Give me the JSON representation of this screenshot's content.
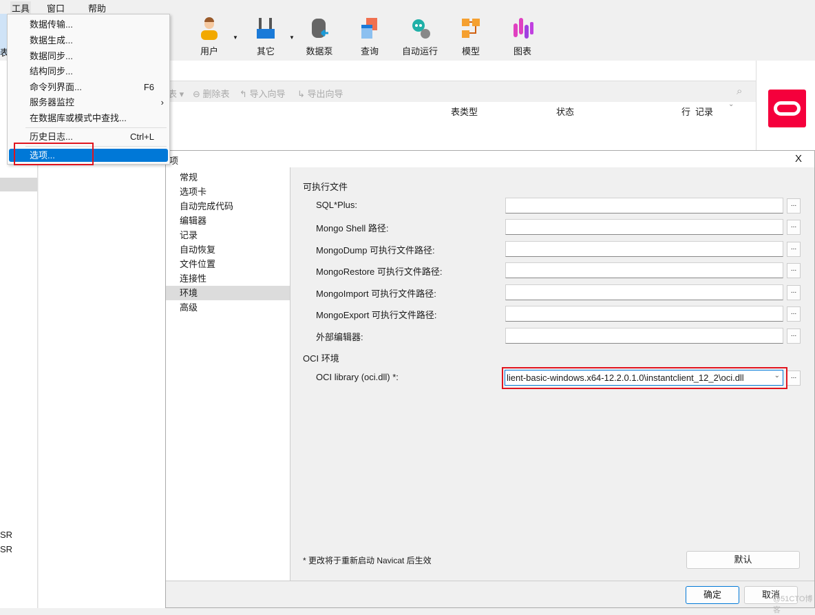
{
  "menubar": {
    "items": [
      "工具",
      "窗口",
      "帮助"
    ]
  },
  "tools_menu": {
    "items": [
      {
        "label": "数据传输..."
      },
      {
        "label": "数据生成..."
      },
      {
        "label": "数据同步..."
      },
      {
        "label": "结构同步..."
      },
      {
        "label": "命令列界面...",
        "shortcut": "F6"
      },
      {
        "label": "服务器监控",
        "submenu": "›"
      },
      {
        "label": "在数据库或模式中查找..."
      },
      {
        "label": "历史日志...",
        "shortcut": "Ctrl+L"
      },
      {
        "label": "选项...",
        "selected": true
      }
    ]
  },
  "toolbar": {
    "items": [
      {
        "label": "用户",
        "icon": "user-icon"
      },
      {
        "label": "其它",
        "icon": "tools-icon"
      },
      {
        "label": "数据泵",
        "icon": "datapump-icon"
      },
      {
        "label": "查询",
        "icon": "query-icon"
      },
      {
        "label": "自动运行",
        "icon": "robot-icon"
      },
      {
        "label": "模型",
        "icon": "model-icon"
      },
      {
        "label": "图表",
        "icon": "chart-icon"
      }
    ]
  },
  "object_toolbar": {
    "items": [
      "表 ▾",
      "删除表",
      "导入向导",
      "导出向导"
    ]
  },
  "table_header": {
    "columns": [
      "表类型",
      "状态",
      "行",
      "记录"
    ]
  },
  "sidebar": {
    "fragments": [
      "表",
      "SR",
      "SR"
    ]
  },
  "dialog": {
    "title": "选项",
    "close": "X",
    "nav": [
      "常规",
      "选项卡",
      "自动完成代码",
      "编辑器",
      "记录",
      "自动恢复",
      "文件位置",
      "连接性",
      "环境",
      "高级"
    ],
    "selected_nav": "环境",
    "section1": "可执行文件",
    "fields": [
      {
        "label": "SQL*Plus:",
        "value": ""
      },
      {
        "label": "Mongo Shell 路径:",
        "value": ""
      },
      {
        "label": "MongoDump 可执行文件路径:",
        "value": ""
      },
      {
        "label": "MongoRestore 可执行文件路径:",
        "value": ""
      },
      {
        "label": "MongoImport 可执行文件路径:",
        "value": ""
      },
      {
        "label": "MongoExport 可执行文件路径:",
        "value": ""
      },
      {
        "label": "外部编辑器:",
        "value": ""
      }
    ],
    "section2": "OCI 环境",
    "oci": {
      "label": "OCI library (oci.dll) *:",
      "value": "lient-basic-windows.x64-12.2.0.1.0\\instantclient_12_2\\oci.dll"
    },
    "browse": "...",
    "note": "* 更改将于重新启动 Navicat 后生效",
    "default_btn": "默认",
    "ok_btn": "确定",
    "cancel_btn": "取消"
  },
  "watermark": "@51CTO博客",
  "colors": {
    "highlight": "#0078d7",
    "annotation": "#e0141e",
    "oracle": "#f5003c"
  }
}
